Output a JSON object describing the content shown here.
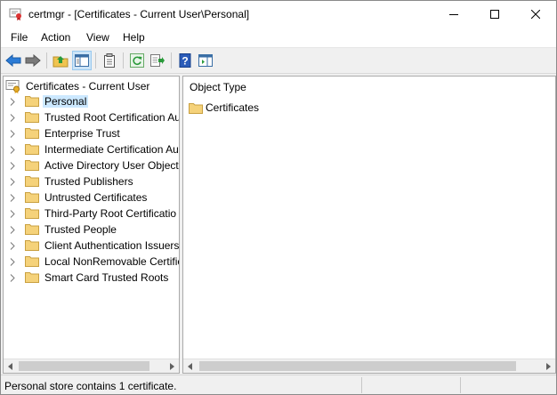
{
  "window": {
    "title": "certmgr - [Certificates - Current User\\Personal]",
    "app_icon": "certificate-manager-icon"
  },
  "menu": [
    "File",
    "Action",
    "View",
    "Help"
  ],
  "toolbar": {
    "icons": [
      "back-arrow-icon",
      "forward-arrow-icon",
      "up-folder-icon",
      "show-hide-console-tree-icon",
      "properties-icon",
      "refresh-icon",
      "export-list-icon",
      "help-icon",
      "action-pane-icon"
    ]
  },
  "tree": {
    "root_label": "Certificates - Current User",
    "items": [
      {
        "label": "Personal",
        "selected": true
      },
      {
        "label": "Trusted Root Certification Au"
      },
      {
        "label": "Enterprise Trust"
      },
      {
        "label": "Intermediate Certification Au"
      },
      {
        "label": "Active Directory User Object"
      },
      {
        "label": "Trusted Publishers"
      },
      {
        "label": "Untrusted Certificates"
      },
      {
        "label": "Third-Party Root Certificatio"
      },
      {
        "label": "Trusted People"
      },
      {
        "label": "Client Authentication Issuers"
      },
      {
        "label": "Local NonRemovable Certific"
      },
      {
        "label": "Smart Card Trusted Roots"
      }
    ]
  },
  "content": {
    "column_header": "Object Type",
    "items": [
      {
        "label": "Certificates"
      }
    ]
  },
  "status": {
    "text": "Personal store contains 1 certificate."
  },
  "colors": {
    "selection": "#cce8ff",
    "folder": "#f5d27a",
    "accent": "#1a6fc9"
  }
}
